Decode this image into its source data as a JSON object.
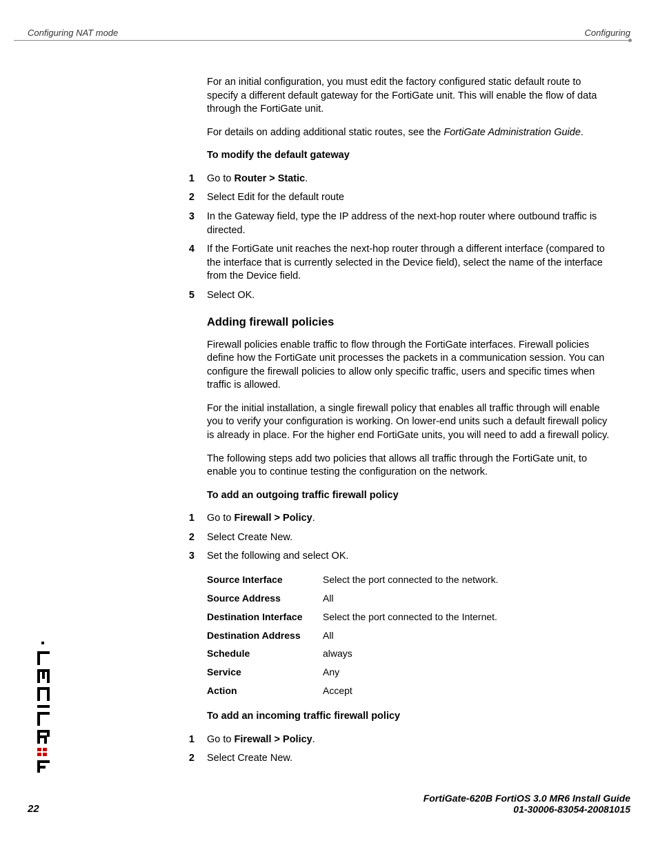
{
  "header": {
    "left": "Configuring NAT mode",
    "right": "Configuring"
  },
  "intro": {
    "p1a": "For an initial configuration, you must edit the factory configured static default route to specify a different default gateway for the FortiGate unit. This will enable the flow of data through the FortiGate unit.",
    "p2a": "For details on adding additional static routes, see the ",
    "p2b": "FortiGate Administration Guide",
    "p2c": "."
  },
  "section1": {
    "heading": "To modify the default gateway",
    "steps": [
      {
        "pre": "Go to ",
        "bold": "Router > Static",
        "post": "."
      },
      {
        "text": "Select Edit for the default route"
      },
      {
        "text": "In the Gateway field, type the IP address of the next-hop router where outbound traffic is directed."
      },
      {
        "text": "If the FortiGate unit reaches the next-hop router through a different interface (compared to the interface that is currently selected in the Device field), select the name of the interface from the Device field."
      },
      {
        "text": "Select OK."
      }
    ]
  },
  "section2": {
    "title": "Adding firewall policies",
    "p1": "Firewall policies enable traffic to flow through the FortiGate interfaces. Firewall policies define how the FortiGate unit processes the packets in a communication session. You can configure the firewall policies to allow only specific traffic, users and specific times when traffic is allowed.",
    "p2": "For the initial installation, a single firewall policy that enables all traffic through will enable you to verify your configuration is working. On lower-end units such a default firewall policy is already in place. For the higher end FortiGate units, you will need to add a firewall policy.",
    "p3": "The following steps add two policies that allows all traffic through the FortiGate unit, to enable you to continue testing the configuration on the network."
  },
  "section3": {
    "heading": "To add an outgoing traffic firewall policy",
    "steps": [
      {
        "pre": "Go to ",
        "bold": "Firewall > Policy",
        "post": "."
      },
      {
        "text": "Select Create New."
      },
      {
        "text": "Set the following and select OK."
      }
    ],
    "table": [
      {
        "key": "Source Interface",
        "val": "Select the port connected to the network."
      },
      {
        "key": "Source Address",
        "val": "All"
      },
      {
        "key": "Destination Interface",
        "val": "Select the port connected to the Internet."
      },
      {
        "key": "Destination Address",
        "val": "All"
      },
      {
        "key": "Schedule",
        "val": "always"
      },
      {
        "key": "Service",
        "val": "Any"
      },
      {
        "key": "Action",
        "val": "Accept"
      }
    ]
  },
  "section4": {
    "heading": "To add an incoming traffic firewall policy",
    "steps": [
      {
        "pre": "Go to ",
        "bold": "Firewall > Policy",
        "post": "."
      },
      {
        "text": "Select Create New."
      }
    ]
  },
  "footer": {
    "page_num": "22",
    "line1": "FortiGate-620B FortiOS 3.0 MR6 Install Guide",
    "line2": "01-30006-83054-20081015"
  },
  "nums": {
    "n1": "1",
    "n2": "2",
    "n3": "3",
    "n4": "4",
    "n5": "5"
  }
}
